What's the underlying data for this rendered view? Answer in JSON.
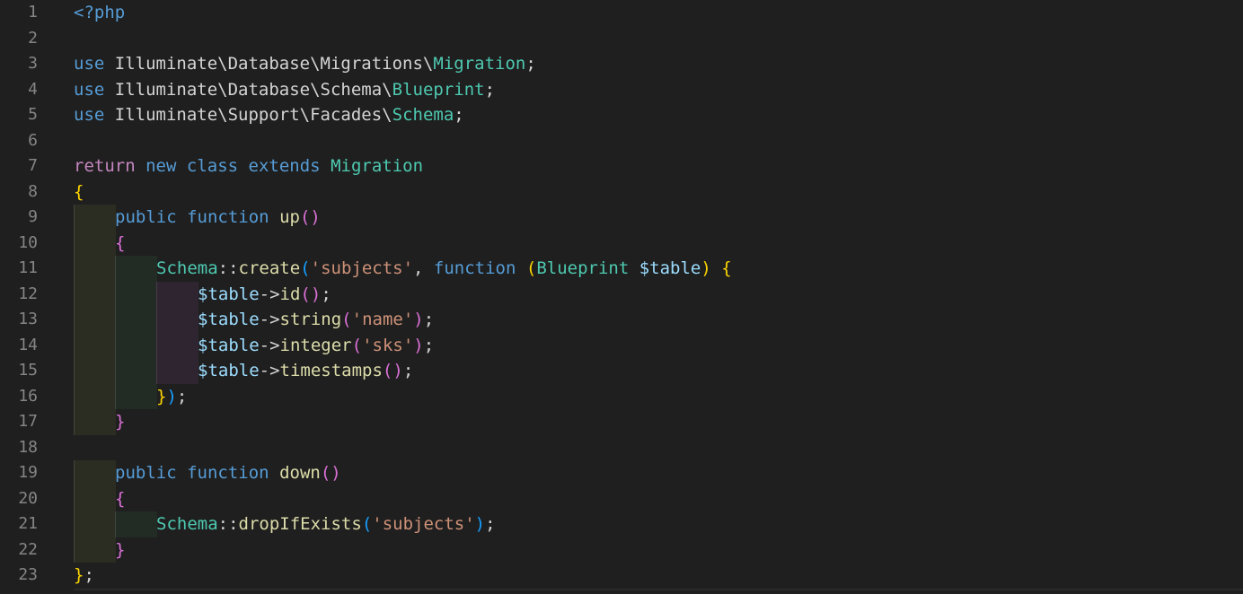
{
  "editor": {
    "line_numbers": [
      "1",
      "2",
      "3",
      "4",
      "5",
      "6",
      "7",
      "8",
      "9",
      "10",
      "11",
      "12",
      "13",
      "14",
      "15",
      "16",
      "17",
      "18",
      "19",
      "20",
      "21",
      "22",
      "23"
    ],
    "lines": [
      {
        "indent": 0,
        "tokens": [
          {
            "c": "kw",
            "t": "<?php"
          }
        ]
      },
      {
        "indent": 0,
        "tokens": []
      },
      {
        "indent": 0,
        "tokens": [
          {
            "c": "kw",
            "t": "use"
          },
          {
            "c": "txt",
            "t": " Illuminate\\Database\\Migrations\\"
          },
          {
            "c": "cls",
            "t": "Migration"
          },
          {
            "c": "txt",
            "t": ";"
          }
        ]
      },
      {
        "indent": 0,
        "tokens": [
          {
            "c": "kw",
            "t": "use"
          },
          {
            "c": "txt",
            "t": " Illuminate\\Database\\Schema\\"
          },
          {
            "c": "cls",
            "t": "Blueprint"
          },
          {
            "c": "txt",
            "t": ";"
          }
        ]
      },
      {
        "indent": 0,
        "tokens": [
          {
            "c": "kw",
            "t": "use"
          },
          {
            "c": "txt",
            "t": " Illuminate\\Support\\Facades\\"
          },
          {
            "c": "cls",
            "t": "Schema"
          },
          {
            "c": "txt",
            "t": ";"
          }
        ]
      },
      {
        "indent": 0,
        "tokens": []
      },
      {
        "indent": 0,
        "tokens": [
          {
            "c": "ctl",
            "t": "return"
          },
          {
            "c": "txt",
            "t": " "
          },
          {
            "c": "kw",
            "t": "new"
          },
          {
            "c": "txt",
            "t": " "
          },
          {
            "c": "kw",
            "t": "class"
          },
          {
            "c": "txt",
            "t": " "
          },
          {
            "c": "kw",
            "t": "extends"
          },
          {
            "c": "txt",
            "t": " "
          },
          {
            "c": "cls",
            "t": "Migration"
          }
        ]
      },
      {
        "indent": 0,
        "tokens": [
          {
            "c": "b1",
            "t": "{"
          }
        ]
      },
      {
        "indent": 1,
        "tokens": [
          {
            "c": "kw",
            "t": "public"
          },
          {
            "c": "txt",
            "t": " "
          },
          {
            "c": "kw",
            "t": "function"
          },
          {
            "c": "txt",
            "t": " "
          },
          {
            "c": "fn",
            "t": "up"
          },
          {
            "c": "b2",
            "t": "()"
          }
        ]
      },
      {
        "indent": 1,
        "tokens": [
          {
            "c": "b2",
            "t": "{"
          }
        ]
      },
      {
        "indent": 2,
        "tokens": [
          {
            "c": "cls",
            "t": "Schema"
          },
          {
            "c": "txt",
            "t": "::"
          },
          {
            "c": "fn",
            "t": "create"
          },
          {
            "c": "b3",
            "t": "("
          },
          {
            "c": "str",
            "t": "'subjects'"
          },
          {
            "c": "txt",
            "t": ", "
          },
          {
            "c": "kw",
            "t": "function"
          },
          {
            "c": "txt",
            "t": " "
          },
          {
            "c": "b1",
            "t": "("
          },
          {
            "c": "cls",
            "t": "Blueprint"
          },
          {
            "c": "txt",
            "t": " "
          },
          {
            "c": "var",
            "t": "$table"
          },
          {
            "c": "b1",
            "t": ")"
          },
          {
            "c": "txt",
            "t": " "
          },
          {
            "c": "b1",
            "t": "{"
          }
        ]
      },
      {
        "indent": 3,
        "tokens": [
          {
            "c": "var",
            "t": "$table"
          },
          {
            "c": "txt",
            "t": "->"
          },
          {
            "c": "fn",
            "t": "id"
          },
          {
            "c": "b2",
            "t": "()"
          },
          {
            "c": "txt",
            "t": ";"
          }
        ]
      },
      {
        "indent": 3,
        "tokens": [
          {
            "c": "var",
            "t": "$table"
          },
          {
            "c": "txt",
            "t": "->"
          },
          {
            "c": "fn",
            "t": "string"
          },
          {
            "c": "b2",
            "t": "("
          },
          {
            "c": "str",
            "t": "'name'"
          },
          {
            "c": "b2",
            "t": ")"
          },
          {
            "c": "txt",
            "t": ";"
          }
        ]
      },
      {
        "indent": 3,
        "tokens": [
          {
            "c": "var",
            "t": "$table"
          },
          {
            "c": "txt",
            "t": "->"
          },
          {
            "c": "fn",
            "t": "integer"
          },
          {
            "c": "b2",
            "t": "("
          },
          {
            "c": "str",
            "t": "'sks'"
          },
          {
            "c": "b2",
            "t": ")"
          },
          {
            "c": "txt",
            "t": ";"
          }
        ]
      },
      {
        "indent": 3,
        "tokens": [
          {
            "c": "var",
            "t": "$table"
          },
          {
            "c": "txt",
            "t": "->"
          },
          {
            "c": "fn",
            "t": "timestamps"
          },
          {
            "c": "b2",
            "t": "()"
          },
          {
            "c": "txt",
            "t": ";"
          }
        ]
      },
      {
        "indent": 2,
        "tokens": [
          {
            "c": "b1",
            "t": "}"
          },
          {
            "c": "b3",
            "t": ")"
          },
          {
            "c": "txt",
            "t": ";"
          }
        ]
      },
      {
        "indent": 1,
        "tokens": [
          {
            "c": "b2",
            "t": "}"
          }
        ]
      },
      {
        "indent": 0,
        "tokens": []
      },
      {
        "indent": 1,
        "tokens": [
          {
            "c": "kw",
            "t": "public"
          },
          {
            "c": "txt",
            "t": " "
          },
          {
            "c": "kw",
            "t": "function"
          },
          {
            "c": "txt",
            "t": " "
          },
          {
            "c": "fn",
            "t": "down"
          },
          {
            "c": "b2",
            "t": "()"
          }
        ]
      },
      {
        "indent": 1,
        "tokens": [
          {
            "c": "b2",
            "t": "{"
          }
        ]
      },
      {
        "indent": 2,
        "tokens": [
          {
            "c": "cls",
            "t": "Schema"
          },
          {
            "c": "txt",
            "t": "::"
          },
          {
            "c": "fn",
            "t": "dropIfExists"
          },
          {
            "c": "b3",
            "t": "("
          },
          {
            "c": "str",
            "t": "'subjects'"
          },
          {
            "c": "b3",
            "t": ")"
          },
          {
            "c": "txt",
            "t": ";"
          }
        ]
      },
      {
        "indent": 1,
        "tokens": [
          {
            "c": "b2",
            "t": "}"
          }
        ]
      },
      {
        "indent": 0,
        "tokens": [
          {
            "c": "b1",
            "t": "}"
          },
          {
            "c": "txt",
            "t": ";"
          }
        ]
      }
    ]
  },
  "colors": {
    "background": "#1f1f1f",
    "keyword": "#569cd6",
    "control": "#c586c0",
    "class": "#4ec9b0",
    "function": "#dcdcaa",
    "variable": "#9cdcfe",
    "string": "#ce9178",
    "bracket_1": "#ffd700",
    "bracket_2": "#da70d6",
    "bracket_3": "#179fff"
  }
}
